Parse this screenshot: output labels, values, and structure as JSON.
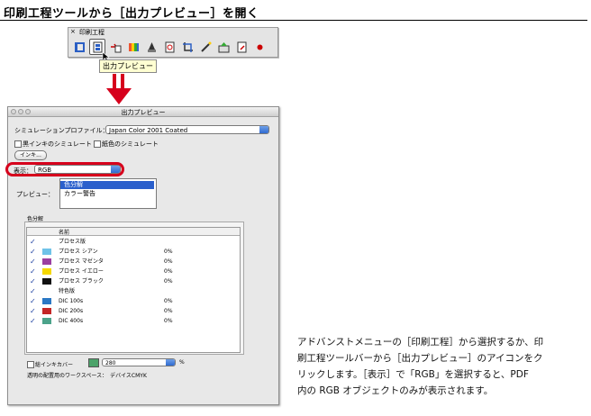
{
  "heading": "印刷工程ツールから［出力プレビュー］を開く",
  "palette": {
    "close": "×",
    "title": "印刷工程"
  },
  "tooltip": "出力プレビュー",
  "window": {
    "title": "出力プレビュー",
    "sim_label": "シミュレーションプロファイル：",
    "sim_value": "Japan Color 2001 Coated",
    "cb_ink": "黒インキのシミュレート",
    "cb_paper": "紙色のシミュレート",
    "ink_button": "インキ...",
    "show_label": "表示：",
    "show_value": "RGB",
    "preview_label": "プレビュー：",
    "preview_items": [
      "色分解",
      "カラー警告"
    ],
    "group_label": "色分解",
    "col_name": "名前",
    "rows": [
      {
        "name": "プロセス版",
        "pct": "",
        "color": ""
      },
      {
        "name": "プロセス シアン",
        "pct": "0%",
        "color": "#6fc3e8"
      },
      {
        "name": "プロセス マゼンタ",
        "pct": "0%",
        "color": "#9b3fa0"
      },
      {
        "name": "プロセス イエロー",
        "pct": "0%",
        "color": "#f5d800"
      },
      {
        "name": "プロセス ブラック",
        "pct": "0%",
        "color": "#111111"
      },
      {
        "name": "特色版",
        "pct": "",
        "color": ""
      },
      {
        "name": "DIC 100s",
        "pct": "0%",
        "color": "#2b78c4"
      },
      {
        "name": "DIC 200s",
        "pct": "0%",
        "color": "#c42626"
      },
      {
        "name": "DIC 400s",
        "pct": "0%",
        "color": "#4ca38a"
      }
    ],
    "cb_coverage": "総インキカバー",
    "coverage_value": "280",
    "coverage_unit": "%",
    "footer": "透明の配置用のワークスペース：　デバイスCMYK"
  },
  "description": [
    "アドバンストメニューの［印刷工程］から選択するか、印",
    "刷工程ツールバーから［出力プレビュー］のアイコンをク",
    "リックします。［表示］で「RGB」を選択すると、PDF",
    "内の RGB オブジェクトのみが表示されます。"
  ],
  "colors": {
    "accent_red": "#d6001c",
    "selection_blue": "#2a5fcc"
  },
  "icons": [
    "output-preview-icon",
    "separations-icon",
    "flattener-icon",
    "color-convert-icon",
    "ink-manager-icon",
    "trap-icon",
    "fix-hairlines-icon",
    "add-marks-icon",
    "crop-icon",
    "transparency-icon",
    "preflight-icon",
    "pointer-cursor-icon"
  ]
}
